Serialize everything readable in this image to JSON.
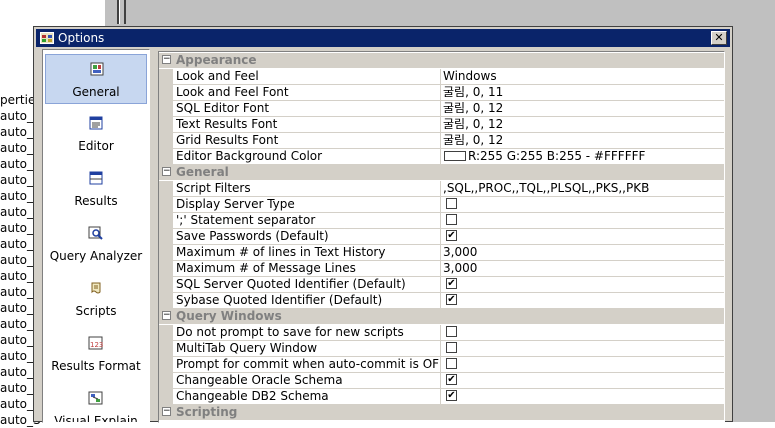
{
  "window": {
    "title": "Options",
    "close_label": "✕"
  },
  "background_list": [
    "perties",
    "auto_A",
    "auto_A",
    "auto_B",
    "auto_C",
    "auto_C",
    "auto_C",
    "auto_E",
    "auto_E",
    "auto_E",
    "auto_E",
    "auto_M",
    "auto_M",
    "auto_N",
    "auto_N",
    "auto_N",
    "auto_N",
    "auto_P",
    "auto_P",
    "auto_P",
    "auto_S"
  ],
  "nav": [
    {
      "label": "General",
      "icon": "general-icon",
      "selected": true
    },
    {
      "label": "Editor",
      "icon": "editor-icon",
      "selected": false
    },
    {
      "label": "Results",
      "icon": "results-icon",
      "selected": false
    },
    {
      "label": "Query Analyzer",
      "icon": "query-analyzer-icon",
      "selected": false
    },
    {
      "label": "Scripts",
      "icon": "scripts-icon",
      "selected": false
    },
    {
      "label": "Results Format",
      "icon": "results-format-icon",
      "selected": false
    },
    {
      "label": "Visual Explain",
      "icon": "visual-explain-icon",
      "selected": false
    }
  ],
  "sections": [
    {
      "title": "Appearance",
      "toggle": "−",
      "rows": [
        {
          "name": "Look and Feel",
          "value": "Windows",
          "type": "text"
        },
        {
          "name": "Look and Feel Font",
          "value": "굴림, 0, 11",
          "type": "text"
        },
        {
          "name": "SQL Editor Font",
          "value": "굴림, 0, 12",
          "type": "text"
        },
        {
          "name": "Text Results Font",
          "value": "굴림, 0, 12",
          "type": "text"
        },
        {
          "name": "Grid Results Font",
          "value": "굴림, 0, 12",
          "type": "text"
        },
        {
          "name": "Editor Background Color",
          "value": "R:255 G:255 B:255 - #FFFFFF",
          "type": "color",
          "color": "#FFFFFF"
        }
      ]
    },
    {
      "title": "General",
      "toggle": "−",
      "rows": [
        {
          "name": "Script Filters",
          "value": ",SQL,,PROC,,TQL,,PLSQL,,PKS,,PKB",
          "type": "text"
        },
        {
          "name": "Display Server Type",
          "checked": false,
          "type": "check"
        },
        {
          "name": "';' Statement separator",
          "checked": false,
          "type": "check"
        },
        {
          "name": "Save Passwords (Default)",
          "checked": true,
          "type": "check"
        },
        {
          "name": "Maximum # of lines in Text History",
          "value": "3,000",
          "type": "text"
        },
        {
          "name": "Maximum # of Message Lines",
          "value": "3,000",
          "type": "text"
        },
        {
          "name": "SQL Server Quoted Identifier (Default)",
          "checked": true,
          "type": "check"
        },
        {
          "name": "Sybase Quoted Identifier (Default)",
          "checked": true,
          "type": "check"
        }
      ]
    },
    {
      "title": "Query Windows",
      "toggle": "−",
      "rows": [
        {
          "name": "Do not prompt to save for new scripts",
          "checked": false,
          "type": "check"
        },
        {
          "name": "MultiTab Query Window",
          "checked": false,
          "type": "check"
        },
        {
          "name": "Prompt for commit when auto-commit is OFF",
          "checked": false,
          "type": "check"
        },
        {
          "name": "Changeable Oracle Schema",
          "checked": true,
          "type": "check"
        },
        {
          "name": "Changeable DB2 Schema",
          "checked": true,
          "type": "check"
        }
      ]
    },
    {
      "title": "Scripting",
      "toggle": "−",
      "rows": []
    }
  ],
  "check_mark": "✔"
}
